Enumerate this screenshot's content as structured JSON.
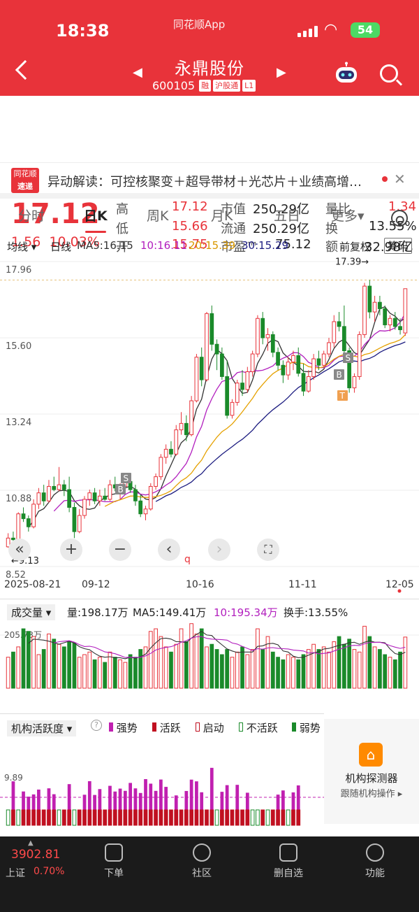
{
  "status_bar": {
    "time": "18:38",
    "app_label": "同花顺App",
    "battery": "54"
  },
  "header": {
    "stock_name": "永鼎股份",
    "stock_code": "600105",
    "tags": [
      "融",
      "沪股通",
      "L1"
    ]
  },
  "quote": {
    "price": "17.12",
    "change": "1.56",
    "change_pct": "10.03%",
    "high_label": "高",
    "high": "17.12",
    "low_label": "低",
    "low": "15.66",
    "open_label": "开",
    "open": "15.75",
    "mktcap_label": "市值",
    "mktcap": "250.29亿",
    "float_label": "流通",
    "float": "250.29亿",
    "pe_label": "市盈™",
    "pe": "75.12",
    "vr_label": "量比",
    "vr": "1.34",
    "turnover_label": "换",
    "turnover": "13.55%",
    "amount_label": "额",
    "amount": "32.98亿"
  },
  "news": {
    "logo_top": "同花顺",
    "logo_bottom": "速递",
    "text": "异动解读：可控核聚变＋超导带材＋光芯片＋业绩高增…"
  },
  "tabs": [
    "分时",
    "日K",
    "周K",
    "月K",
    "五日",
    "更多▾"
  ],
  "kline_bar": {
    "indicator": "均线",
    "period": "日线",
    "ma5": "MA5:16.15",
    "ma10": "10:16.11",
    "ma20": "20:15.39",
    "ma30": "30:15.29",
    "adjust": "前复权",
    "chips": "筹码"
  },
  "colors": {
    "up": "#e8333a",
    "down": "#1a8a2a",
    "ma5": "#333333",
    "ma10": "#b21fbe",
    "ma20": "#e5a100",
    "ma30": "#1c1c80",
    "bg_header": "#e8333a"
  },
  "chart_data": [
    {
      "type": "candlestick",
      "y_ticks": [
        "17.96",
        "15.60",
        "13.24",
        "10.88",
        "8.52"
      ],
      "x_ticks": [
        "2025-08-21",
        "09-12",
        "10-16",
        "11-11",
        "12-05"
      ],
      "ylim": [
        8.52,
        17.96
      ],
      "annotations": {
        "high": "17.39→",
        "low": "←9.13",
        "signals": [
          "S",
          "B",
          "S",
          "B",
          "T",
          "q"
        ]
      },
      "ohlc": [
        [
          9.13,
          9.55,
          9.1,
          9.4
        ],
        [
          9.4,
          9.6,
          9.25,
          9.35
        ],
        [
          9.35,
          10.2,
          9.3,
          10.15
        ],
        [
          10.15,
          10.35,
          9.9,
          10.0
        ],
        [
          10.0,
          10.1,
          9.6,
          9.75
        ],
        [
          9.75,
          10.6,
          9.7,
          10.45
        ],
        [
          10.45,
          10.95,
          10.3,
          10.8
        ],
        [
          10.8,
          11.05,
          10.4,
          10.55
        ],
        [
          10.55,
          11.2,
          10.5,
          11.0
        ],
        [
          11.0,
          11.3,
          10.85,
          10.9
        ],
        [
          10.9,
          11.6,
          10.85,
          11.05
        ],
        [
          11.05,
          11.2,
          10.7,
          10.9
        ],
        [
          10.9,
          11.3,
          10.2,
          10.35
        ],
        [
          10.35,
          10.5,
          9.4,
          9.6
        ],
        [
          9.6,
          10.3,
          9.55,
          10.1
        ],
        [
          10.1,
          10.7,
          10.0,
          10.6
        ],
        [
          10.6,
          10.9,
          10.4,
          10.8
        ],
        [
          10.8,
          10.95,
          10.45,
          10.55
        ],
        [
          10.55,
          10.9,
          10.4,
          10.7
        ],
        [
          10.7,
          10.95,
          10.55,
          10.6
        ],
        [
          10.6,
          11.2,
          10.55,
          11.05
        ],
        [
          11.05,
          11.3,
          10.85,
          10.95
        ],
        [
          10.95,
          11.1,
          10.6,
          11.0
        ],
        [
          11.0,
          11.35,
          10.9,
          11.15
        ],
        [
          11.15,
          11.25,
          10.8,
          10.9
        ],
        [
          10.9,
          11.05,
          10.4,
          10.55
        ],
        [
          10.55,
          10.75,
          10.05,
          10.15
        ],
        [
          10.15,
          10.4,
          9.95,
          10.3
        ],
        [
          10.3,
          11.1,
          10.25,
          11.0
        ],
        [
          11.0,
          11.4,
          10.9,
          11.3
        ],
        [
          11.3,
          12.0,
          11.2,
          11.9
        ],
        [
          11.9,
          12.3,
          11.7,
          12.15
        ],
        [
          12.15,
          12.4,
          11.9,
          12.0
        ],
        [
          12.0,
          12.9,
          11.95,
          12.75
        ],
        [
          12.75,
          13.3,
          12.6,
          12.95
        ],
        [
          12.95,
          13.2,
          12.4,
          12.6
        ],
        [
          12.6,
          13.8,
          12.55,
          13.65
        ],
        [
          13.65,
          15.1,
          13.6,
          15.0
        ],
        [
          15.0,
          15.3,
          14.1,
          14.3
        ],
        [
          14.3,
          16.4,
          14.25,
          16.35
        ],
        [
          16.35,
          16.6,
          15.2,
          15.4
        ],
        [
          15.4,
          15.55,
          14.6,
          15.1
        ],
        [
          15.1,
          15.3,
          14.3,
          14.4
        ],
        [
          14.4,
          14.9,
          13.1,
          13.2
        ],
        [
          13.2,
          13.7,
          13.1,
          13.6
        ],
        [
          13.6,
          14.3,
          13.5,
          14.2
        ],
        [
          14.2,
          14.6,
          13.8,
          14.0
        ],
        [
          14.0,
          14.7,
          13.9,
          14.55
        ],
        [
          14.55,
          15.2,
          14.4,
          15.1
        ],
        [
          15.1,
          16.3,
          15.0,
          16.2
        ],
        [
          16.2,
          16.4,
          15.4,
          15.6
        ],
        [
          15.6,
          15.9,
          15.2,
          15.7
        ],
        [
          15.7,
          15.8,
          15.0,
          15.15
        ],
        [
          15.15,
          15.3,
          14.6,
          14.75
        ],
        [
          14.75,
          14.9,
          14.2,
          14.45
        ],
        [
          14.45,
          15.0,
          14.3,
          14.85
        ],
        [
          14.85,
          15.2,
          14.6,
          15.05
        ],
        [
          15.05,
          15.3,
          14.4,
          14.5
        ],
        [
          14.5,
          14.8,
          13.8,
          13.95
        ],
        [
          13.95,
          14.6,
          13.9,
          14.4
        ],
        [
          14.4,
          15.1,
          14.3,
          14.95
        ],
        [
          14.95,
          15.2,
          14.6,
          14.75
        ],
        [
          14.75,
          15.2,
          14.7,
          15.1
        ],
        [
          15.1,
          15.6,
          15.0,
          15.45
        ],
        [
          15.45,
          16.3,
          15.3,
          16.1
        ],
        [
          16.1,
          16.4,
          15.8,
          15.95
        ],
        [
          15.95,
          16.6,
          15.0,
          15.2
        ],
        [
          15.2,
          15.3,
          13.9,
          14.05
        ],
        [
          14.05,
          14.5,
          13.9,
          14.4
        ],
        [
          14.4,
          15.8,
          14.3,
          15.7
        ],
        [
          15.7,
          17.3,
          15.6,
          17.2
        ],
        [
          17.2,
          17.39,
          16.2,
          16.4
        ],
        [
          16.4,
          16.9,
          16.1,
          16.7
        ],
        [
          16.7,
          16.9,
          16.3,
          16.5
        ],
        [
          16.5,
          16.6,
          15.9,
          16.0
        ],
        [
          16.0,
          16.3,
          15.8,
          16.2
        ],
        [
          16.2,
          16.4,
          15.85,
          15.95
        ],
        [
          15.95,
          16.2,
          15.7,
          15.85
        ],
        [
          15.75,
          17.12,
          15.66,
          17.12
        ]
      ]
    },
    {
      "type": "bar",
      "title": "成交量",
      "readout": {
        "vol": "量:198.17万",
        "ma5": "MA5:149.41万",
        "ma10": "10:195.34万",
        "turnover": "换手:13.55%"
      },
      "y_tick": "205.73万",
      "values": [
        120,
        140,
        160,
        230,
        220,
        200,
        130,
        150,
        210,
        190,
        170,
        160,
        180,
        175,
        120,
        130,
        140,
        110,
        120,
        100,
        140,
        120,
        110,
        100,
        130,
        120,
        150,
        160,
        220,
        230,
        200,
        160,
        140,
        170,
        230,
        180,
        250,
        210,
        230,
        160,
        170,
        150,
        130,
        150,
        120,
        140,
        160,
        130,
        150,
        230,
        150,
        200,
        140,
        120,
        110,
        130,
        120,
        110,
        130,
        150,
        170,
        150,
        160,
        140,
        180,
        200,
        170,
        190,
        150,
        140,
        240,
        200,
        160,
        150,
        130,
        120,
        110,
        140,
        198
      ]
    },
    {
      "type": "bar",
      "title": "机构活跃度",
      "legend": [
        "强势",
        "活跃",
        "启动",
        "不活跃",
        "弱势"
      ],
      "y_tick": "9.89"
    }
  ],
  "inst_detector": {
    "title": "机构探测器",
    "subtitle": "跟随机构操作 ▸"
  },
  "bottom_nav": {
    "index_value": "3902.81",
    "index_name": "上证",
    "index_pct": "0.70%",
    "items": [
      "下单",
      "社区",
      "删自选",
      "功能"
    ]
  }
}
